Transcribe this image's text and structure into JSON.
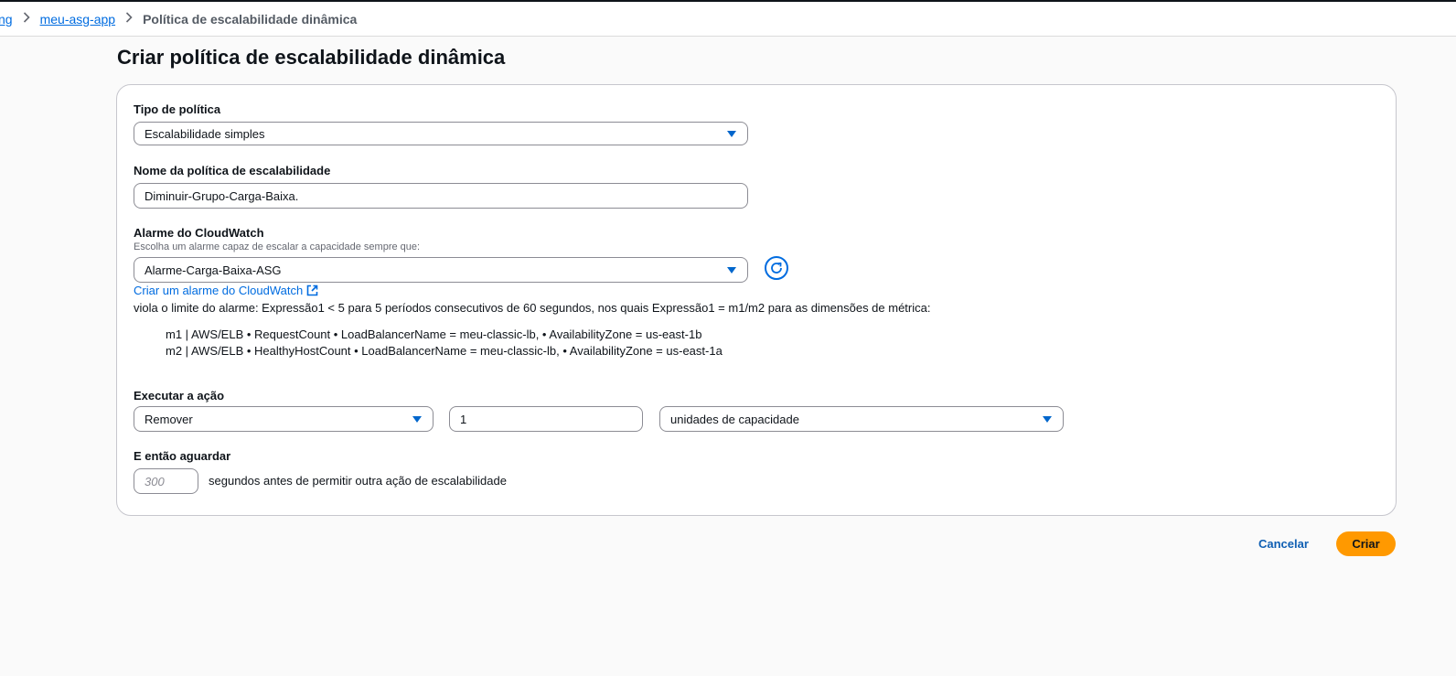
{
  "breadcrumb": {
    "first": "ng",
    "second": "meu-asg-app",
    "current": "Política de escalabilidade dinâmica"
  },
  "page": {
    "title": "Criar política de escalabilidade dinâmica"
  },
  "form": {
    "policy_type": {
      "label": "Tipo de política",
      "value": "Escalabilidade simples"
    },
    "policy_name": {
      "label": "Nome da política de escalabilidade",
      "value": "Diminuir-Grupo-Carga-Baixa."
    },
    "alarm": {
      "label": "Alarme do CloudWatch",
      "description": "Escolha um alarme capaz de escalar a capacidade sempre que:",
      "value": "Alarme-Carga-Baixa-ASG",
      "create_link": "Criar um alarme do CloudWatch",
      "condition": "viola o limite do alarme: Expressão1 < 5 para 5 períodos consecutivos de 60 segundos, nos quais Expressão1 = m1/m2 para as dimensões de métrica:",
      "metrics": [
        "m1 | AWS/ELB • RequestCount • LoadBalancerName = meu-classic-lb, • AvailabilityZone = us-east-1b",
        "m2 | AWS/ELB • HealthyHostCount • LoadBalancerName = meu-classic-lb, • AvailabilityZone = us-east-1a"
      ]
    },
    "action": {
      "label": "Executar a ação",
      "operation": "Remover",
      "amount": "1",
      "unit": "unidades de capacidade"
    },
    "wait": {
      "label": "E então aguardar",
      "placeholder": "300",
      "suffix": "segundos antes de permitir outra ação de escalabilidade"
    }
  },
  "footer": {
    "cancel_label": "Cancelar",
    "create_label": "Criar"
  },
  "colors": {
    "link": "#006ce0",
    "primary_button": "#ff9900",
    "caret": "#0066cc"
  },
  "icons": {
    "breadcrumb_separator": "chevron-right-icon",
    "dropdown": "caret-down-icon",
    "refresh": "refresh-icon",
    "external_link": "external-link-icon"
  }
}
